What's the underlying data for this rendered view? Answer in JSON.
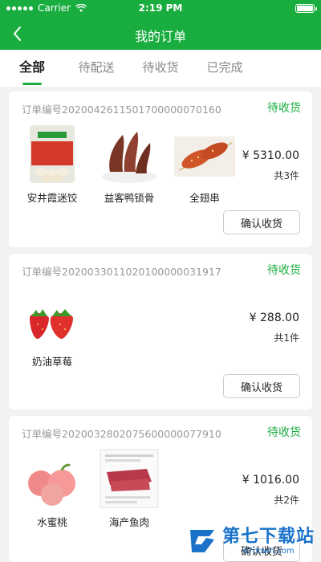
{
  "statusbar": {
    "carrier": "Carrier",
    "time": "2:19 PM"
  },
  "navbar": {
    "title": "我的订单"
  },
  "tabs": [
    {
      "label": "全部"
    },
    {
      "label": "待配送"
    },
    {
      "label": "待收货"
    },
    {
      "label": "已完成"
    }
  ],
  "orders": [
    {
      "order_no": "订单编号2020042611501700000070160",
      "status": "待收货",
      "items": [
        {
          "name": "安井霞迷饺",
          "icon": "dumpling-bag-icon"
        },
        {
          "name": "益客鸭锁骨",
          "icon": "duck-neck-icon"
        },
        {
          "name": "全翅串",
          "icon": "chicken-wing-skewer-icon"
        }
      ],
      "price": "¥ 5310.00",
      "count": "共3件",
      "action": "确认收货"
    },
    {
      "order_no": "订单编号2020033011020100000031917",
      "status": "待收货",
      "items": [
        {
          "name": "奶油草莓",
          "icon": "strawberry-icon"
        }
      ],
      "price": "¥ 288.00",
      "count": "共1件",
      "action": "确认收货"
    },
    {
      "order_no": "订单编号2020032802075600000077910",
      "status": "待收货",
      "items": [
        {
          "name": "水蜜桃",
          "icon": "peach-icon"
        },
        {
          "name": "海产鱼肉",
          "icon": "fish-meat-icon"
        }
      ],
      "price": "¥ 1016.00",
      "count": "共2件",
      "action": "确认收货"
    }
  ],
  "watermark": {
    "text": "第七下载站",
    "url": "d7down.com"
  },
  "colors": {
    "brand_green": "#19ad3f",
    "watermark_blue": "#1a73c9"
  }
}
